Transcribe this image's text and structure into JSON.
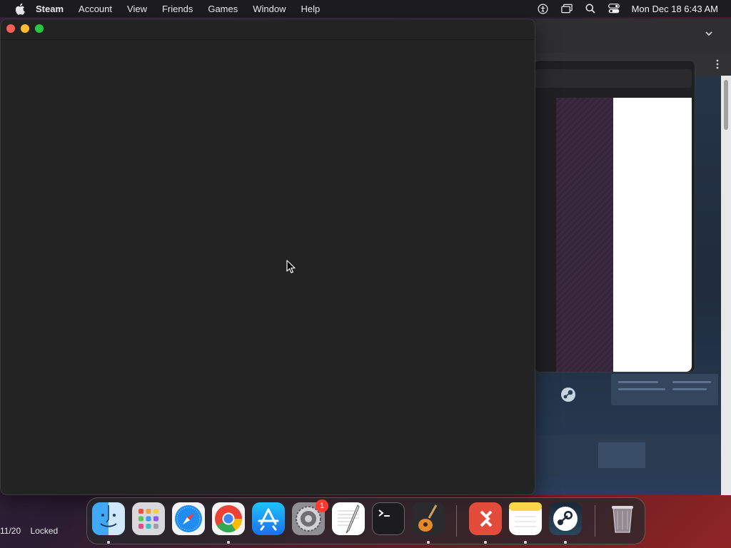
{
  "menubar": {
    "app_name": "Steam",
    "items": [
      "Account",
      "View",
      "Friends",
      "Games",
      "Window",
      "Help"
    ],
    "clock": "Mon Dec 18  6:43 AM"
  },
  "status": {
    "counter": "11/20",
    "lock_state": "Locked"
  },
  "dock": {
    "apps": [
      {
        "name": "Finder",
        "icon": "finder-icon",
        "running": true
      },
      {
        "name": "Launchpad",
        "icon": "launchpad-icon",
        "running": false
      },
      {
        "name": "Safari",
        "icon": "safari-icon",
        "running": false
      },
      {
        "name": "Google Chrome",
        "icon": "chrome-icon",
        "running": true
      },
      {
        "name": "App Store",
        "icon": "app-store-icon",
        "running": false
      },
      {
        "name": "System Settings",
        "icon": "settings-icon",
        "running": false,
        "badge": "1"
      },
      {
        "name": "TextEdit",
        "icon": "textedit-icon",
        "running": false
      },
      {
        "name": "Terminal",
        "icon": "terminal-icon",
        "running": false
      },
      {
        "name": "GarageBand",
        "icon": "garageband-icon",
        "running": true
      },
      {
        "name": "Microsoft Remote Desktop",
        "icon": "remote-desktop-icon",
        "running": true
      },
      {
        "name": "Notes",
        "icon": "notes-icon",
        "running": true
      },
      {
        "name": "Steam",
        "icon": "steam-icon",
        "running": true
      },
      {
        "name": "Trash",
        "icon": "trash-icon",
        "running": false
      }
    ]
  },
  "colors": {
    "menubar_bg": "#1d1d1f",
    "steam_window_bg": "#232323",
    "close": "#ff5f57",
    "minimize": "#febc2e",
    "maximize": "#28c840",
    "badge": "#ff3b30"
  }
}
